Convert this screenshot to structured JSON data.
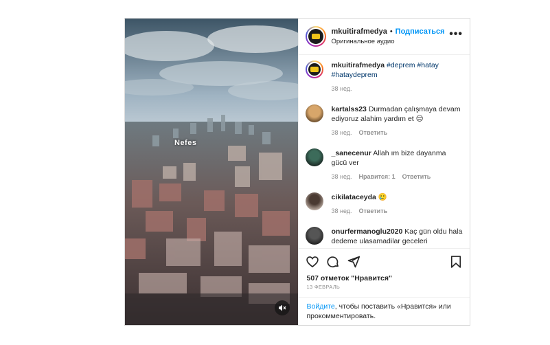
{
  "post": {
    "media": {
      "overlay_text": "Nefes",
      "mute_icon": "speaker-muted-icon"
    },
    "header": {
      "username": "mkuitirafmedya",
      "separator": "•",
      "follow_label": "Подписаться",
      "audio_label": "Оригинальное аудио",
      "more_icon": "more-horizontal-icon"
    },
    "caption": {
      "username": "mkuitirafmedya",
      "hashtags": "#deprem #hatay #hataydeprem",
      "time": "38 нед."
    },
    "comments": [
      {
        "username": "kartalss23",
        "text": "Durmadan çalışmaya devam ediyoruz alahim yardım et 😔",
        "time": "38 нед.",
        "likes": "",
        "reply": "Ответить"
      },
      {
        "username": "_sanecenur",
        "text": "Allah ım bize dayanma gücü ver",
        "time": "38 нед.",
        "likes": "Нравится: 1",
        "reply": "Ответить"
      },
      {
        "username": "cikilataceyda",
        "text": "🥲",
        "time": "38 нед.",
        "likes": "",
        "reply": "Ответить"
      },
      {
        "username": "onurfermanoglu2020",
        "text": "Kaç gün oldu hala dedeme ulasamadilar geceleri",
        "time": "",
        "likes": "",
        "reply": ""
      }
    ],
    "actions": {
      "like_icon": "heart-icon",
      "comment_icon": "comment-icon",
      "share_icon": "send-icon",
      "save_icon": "bookmark-icon"
    },
    "likes_text": "507 отметок \"Нравится\"",
    "date": "13 ФЕВРАЛЬ",
    "login": {
      "link": "Войдите",
      "rest": ", чтобы поставить «Нравится» или прокомментировать."
    }
  }
}
